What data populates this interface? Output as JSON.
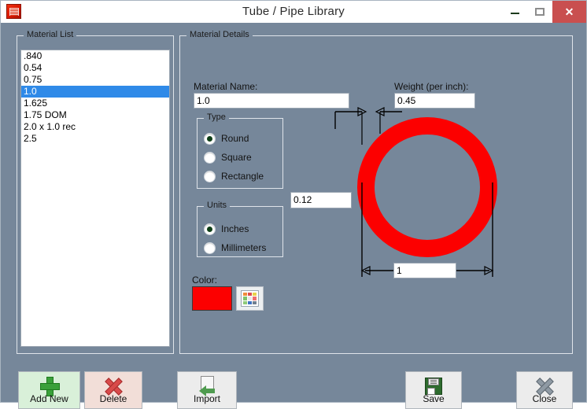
{
  "window": {
    "title": "Tube / Pipe  Library",
    "app_icon": "document-red-icon",
    "minimize_label": "–",
    "maximize_label": "□",
    "close_label": "✕",
    "close_button_color": "#c94f4f"
  },
  "material_list": {
    "group_title": "Material List",
    "items": [
      ".840",
      "0.54",
      "0.75",
      "1.0",
      "1.625",
      "1.75 DOM",
      "2.0 x 1.0 rec",
      "2.5"
    ],
    "selected_index": 3,
    "selection_color": "#2f8ae8"
  },
  "material_details": {
    "group_title": "Material Details",
    "material_name_label": "Material Name:",
    "material_name_value": "1.0",
    "weight_label": "Weight (per inch):",
    "weight_value": "0.45",
    "type": {
      "group_title": "Type",
      "options": [
        "Round",
        "Square",
        "Rectangle"
      ],
      "selected": "Round"
    },
    "units": {
      "group_title": "Units",
      "options": [
        "Inches",
        "Millimeters"
      ],
      "selected": "Inches"
    },
    "color": {
      "label": "Color:",
      "swatch_color": "#fc0000",
      "picker_icon": "color-palette-icon",
      "palette_colors": [
        "#f08c3a",
        "#dd4d4d",
        "#e8d24a",
        "#7fc36b",
        "#e8e8e8",
        "#ef6f6f",
        "#8ecb7a",
        "#3f73c4",
        "#6f7f90"
      ]
    },
    "diagram": {
      "shape": "round-tube",
      "pipe_color": "#fc0000",
      "wall_thickness_value": "0.12",
      "outer_diameter_value": "1"
    }
  },
  "buttons": {
    "add_new": {
      "label": "Add New",
      "icon": "plus-icon"
    },
    "delete": {
      "label": "Delete",
      "icon": "x-red-icon"
    },
    "import": {
      "label": "Import",
      "icon": "import-arrow-icon"
    },
    "save": {
      "label": "Save",
      "icon": "floppy-disk-icon"
    },
    "close": {
      "label": "Close",
      "icon": "x-gray-icon"
    }
  }
}
